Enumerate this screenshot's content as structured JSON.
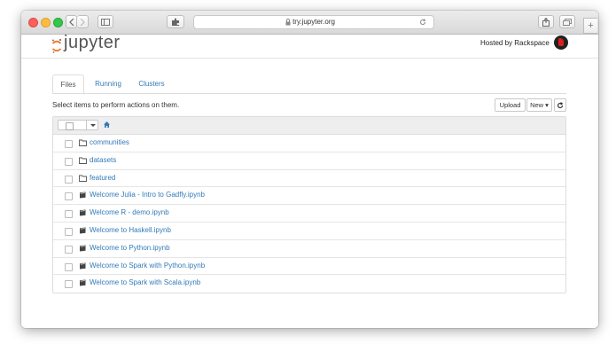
{
  "browser": {
    "url": "try.jupyter.org",
    "back_icon": "chevron-left-icon",
    "forward_icon": "chevron-right-icon",
    "sidebar_icon": "sidebar-icon",
    "extension_icon": "puzzle-icon",
    "reload_icon": "reload-icon",
    "share_icon": "share-icon",
    "tabs_icon": "tabs-icon",
    "new_tab_label": "+"
  },
  "header": {
    "logo_text": "jupyter",
    "hosted_by": "Hosted by Rackspace"
  },
  "tabs": [
    {
      "label": "Files",
      "active": true
    },
    {
      "label": "Running",
      "active": false
    },
    {
      "label": "Clusters",
      "active": false
    }
  ],
  "toolbar": {
    "hint": "Select items to perform actions on them.",
    "upload_label": "Upload",
    "new_label": "New ▾",
    "refresh_icon": "refresh-icon"
  },
  "files": [
    {
      "name": "communities",
      "type": "folder"
    },
    {
      "name": "datasets",
      "type": "folder"
    },
    {
      "name": "featured",
      "type": "folder"
    },
    {
      "name": "Welcome Julia - Intro to Gadfly.ipynb",
      "type": "notebook"
    },
    {
      "name": "Welcome R - demo.ipynb",
      "type": "notebook"
    },
    {
      "name": "Welcome to Haskell.ipynb",
      "type": "notebook"
    },
    {
      "name": "Welcome to Python.ipynb",
      "type": "notebook"
    },
    {
      "name": "Welcome to Spark with Python.ipynb",
      "type": "notebook"
    },
    {
      "name": "Welcome to Spark with Scala.ipynb",
      "type": "notebook"
    }
  ],
  "colors": {
    "link": "#337ab7",
    "jupyter_orange": "#f37726",
    "rackspace_red": "#d9201f"
  }
}
